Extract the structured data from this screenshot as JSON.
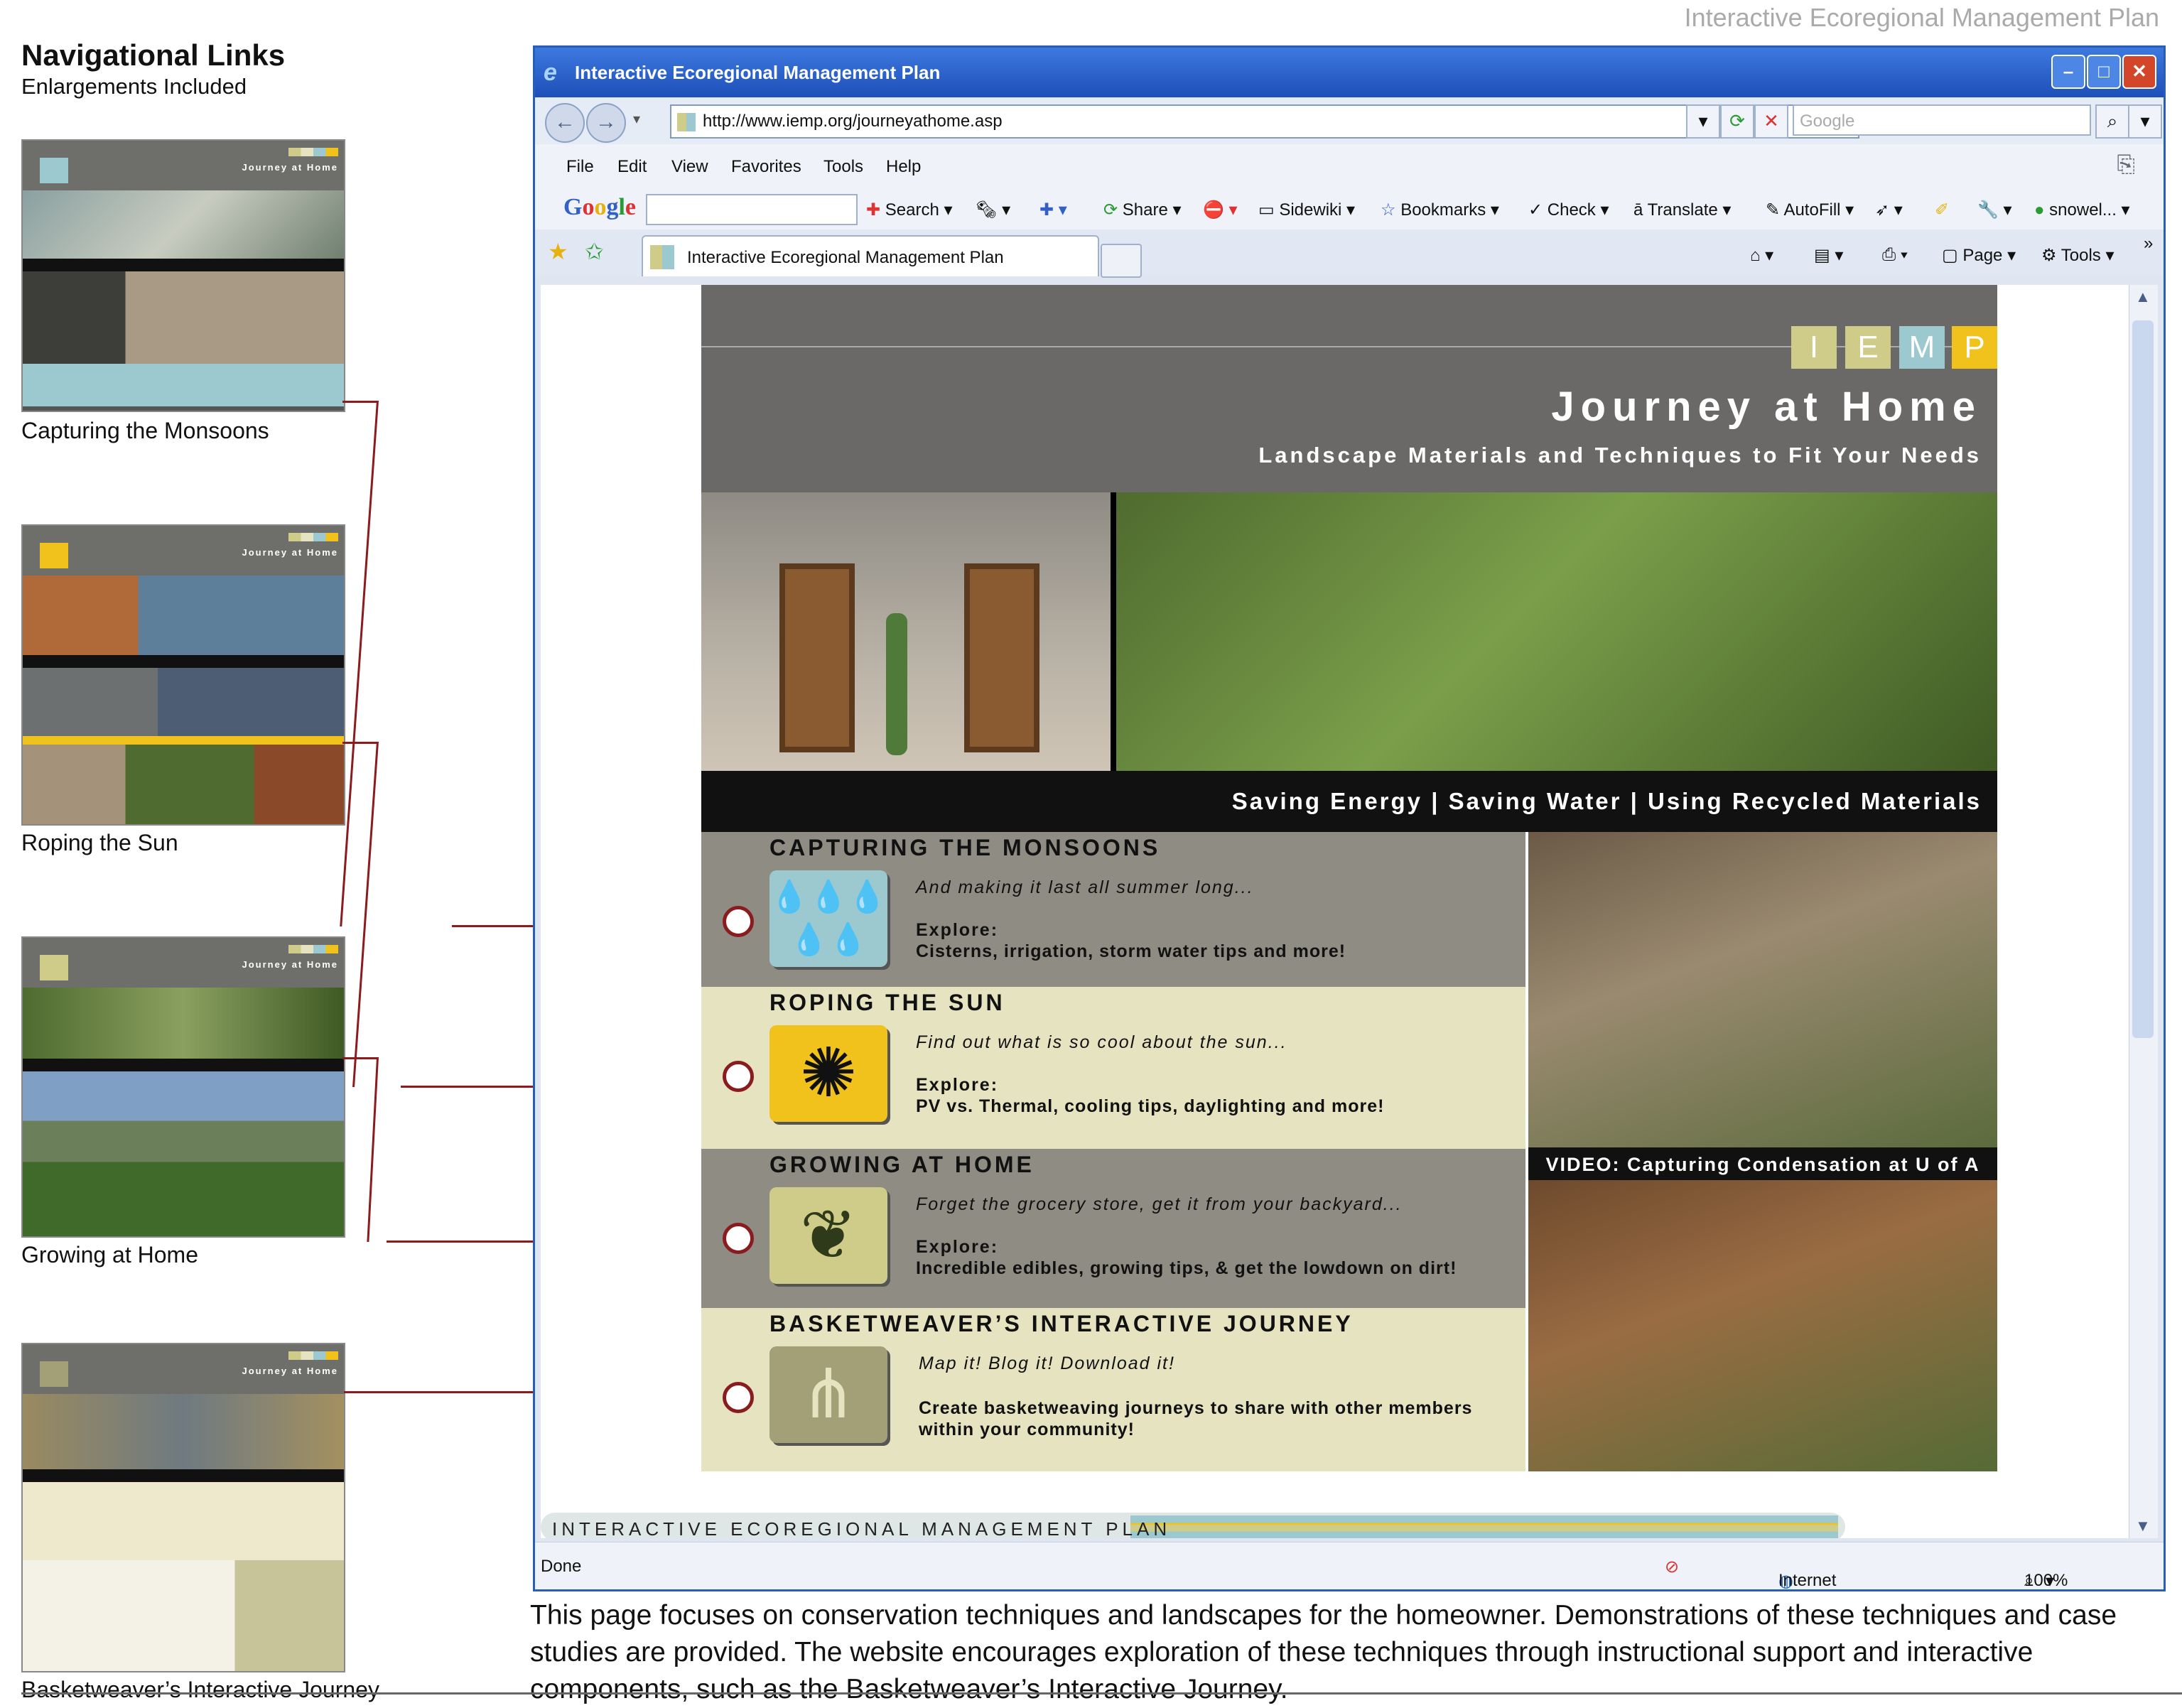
{
  "doc_header": "Interactive Ecoregional Management Plan",
  "nav_panel": {
    "title": "Navigational Links",
    "subtitle": "Enlargements Included",
    "thumbnails": [
      {
        "label": "Capturing the Monsoons",
        "mini_title": "Journey at Home"
      },
      {
        "label": "Roping the Sun",
        "mini_title": "Journey at Home"
      },
      {
        "label": "Growing at Home",
        "mini_title": "Journey at Home"
      },
      {
        "label": "Basketweaver’s Interactive Journey",
        "mini_title": "Journey at Home"
      }
    ]
  },
  "browser": {
    "window_title": "Interactive Ecoregional Management Plan",
    "url": "http://www.iemp.org/journeyathome.asp",
    "search_placeholder": "Google",
    "menu": [
      "File",
      "Edit",
      "View",
      "Favorites",
      "Tools",
      "Help"
    ],
    "toolbar": {
      "google": "Google",
      "search": "Search",
      "share": "Share",
      "sidewiki": "Sidewiki",
      "bookmarks": "Bookmarks",
      "check": "Check",
      "translate": "Translate",
      "autofill": "AutoFill",
      "user": "snowel..."
    },
    "tab_title": "Interactive Ecoregional Management Plan",
    "page_btn": "Page",
    "tools_btn": "Tools",
    "status": {
      "left": "Done",
      "zone": "Internet",
      "zoom": "100%"
    }
  },
  "site": {
    "logo_letters": [
      "I",
      "E",
      "M",
      "P"
    ],
    "logo_colors": [
      "#cfcb88",
      "#cfcb88",
      "#9cc9cf",
      "#f1c21b"
    ],
    "title": "Journey at Home",
    "subtitle": "Landscape Materials and Techniques to Fit Your Needs",
    "tagline": "Saving Energy | Saving Water | Using Recycled Materials",
    "sections": [
      {
        "title": "CAPTURING THE MONSOONS",
        "tagline": "And making it last all summer long...",
        "explore": "Explore:",
        "detail": "Cisterns, irrigation, storm water tips and more!",
        "icon": "raindrops-icon",
        "bg": "#8f8c83",
        "icon_bg": "#9cc9cf"
      },
      {
        "title": "ROPING THE SUN",
        "tagline": "Find out what is so cool about the sun...",
        "explore": "Explore:",
        "detail": "PV vs. Thermal, cooling tips, daylighting and more!",
        "icon": "sun-icon",
        "bg": "#e6e3c1",
        "icon_bg": "#f1c21b"
      },
      {
        "title": "GROWING AT HOME",
        "tagline": "Forget the grocery store, get it from your backyard...",
        "explore": "Explore:",
        "detail": "Incredible edibles, growing tips, & get the lowdown on dirt!",
        "icon": "plant-icon",
        "bg": "#8f8c83",
        "icon_bg": "#cfcb88"
      },
      {
        "title": "BASKETWEAVER’S INTERACTIVE JOURNEY",
        "tagline": "Map it! Blog it! Download it!",
        "explore": "",
        "detail": "Create basketweaving journeys to share with other members within your community!",
        "icon": "grass-icon",
        "bg": "#e6e3c1",
        "icon_bg": "#a39f76"
      }
    ],
    "video_caption": "VIDEO: Capturing Condensation at U of A",
    "footer": "INTERACTIVE ECOREGIONAL MANAGEMENT PLAN"
  },
  "description": "This page focuses on conservation techniques and landscapes for the homeowner. Demonstrations of these techniques and case studies are provided. The website encourages exploration of these techniques through instructional support and interactive components, such as the Basketweaver’s Interactive Journey."
}
